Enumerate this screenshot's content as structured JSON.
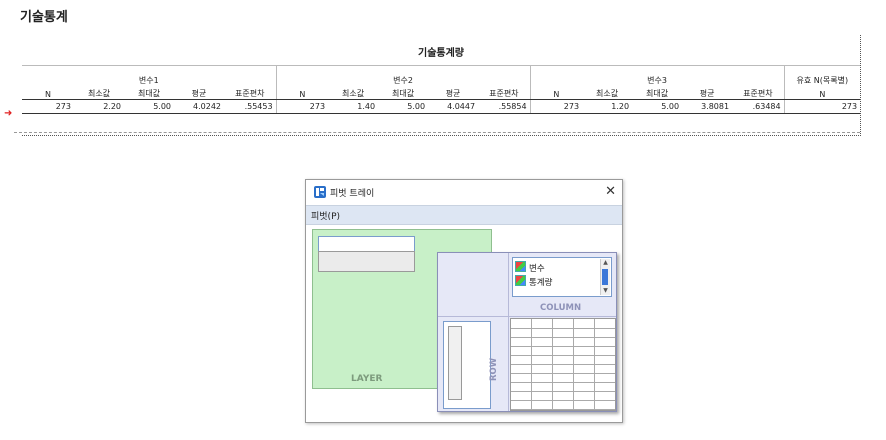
{
  "page": {
    "heading": "기술통계"
  },
  "stats_table": {
    "title": "기술통계량",
    "groups": [
      "변수1",
      "변수2",
      "변수3",
      "유효 N(목록별)"
    ],
    "columns": [
      "N",
      "최소값",
      "최대값",
      "평균",
      "표준편차"
    ],
    "last_column": "N",
    "row": [
      "273",
      "2.20",
      "5.00",
      "4.0242",
      ".55453",
      "273",
      "1.40",
      "5.00",
      "4.0447",
      ".55854",
      "273",
      "1.20",
      "5.00",
      "3.8081",
      ".63484",
      "273"
    ]
  },
  "pivot_dialog": {
    "title": "피벗 트레이",
    "close_glyph": "✕",
    "menu": "피벗(P)",
    "layer_label": "LAYER",
    "column_items": [
      "변수",
      "통계량"
    ],
    "column_label": "COLUMN",
    "row_label": "ROW"
  },
  "colors": {
    "layer": "#c8f0c8",
    "row_column_area": "#e6e8f7",
    "menubar": "#dde6f3",
    "marker": "#e02020"
  }
}
